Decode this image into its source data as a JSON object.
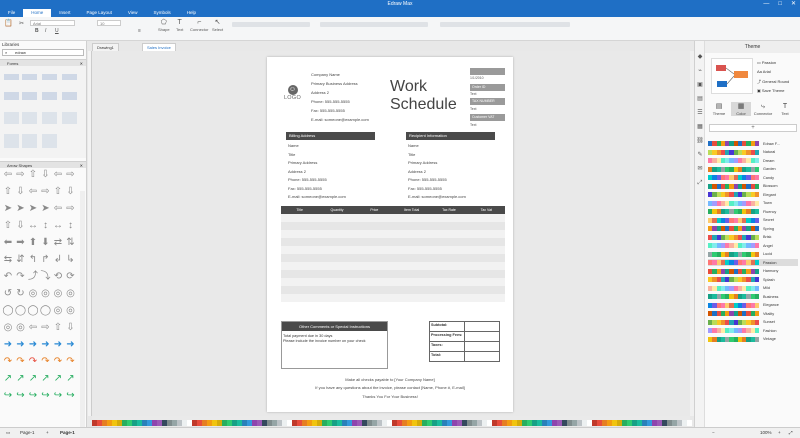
{
  "app": {
    "title": "Edraw Max",
    "win_controls": [
      "—",
      "□",
      "✕"
    ]
  },
  "menu": [
    "File",
    "Home",
    "Insert",
    "Page Layout",
    "View",
    "Symbols",
    "Help"
  ],
  "menu_active": "Home",
  "ribbon": {
    "font_name": "Arial",
    "font_size": "10",
    "tools": [
      "Shape",
      "Text",
      "Connector",
      "Select"
    ]
  },
  "library": {
    "title": "Libraries",
    "search_value": "edraw",
    "section_forms": "Forms",
    "section_arrows": "Arrow Shapes"
  },
  "tabs": [
    "Drawing1",
    "Sales Invoice"
  ],
  "doc": {
    "company_name": "Company Name",
    "address1": "Primary Business Address",
    "address2": "Address 2",
    "phone": "Phone: 555-555-5555",
    "fax": "Fax: 555-555-5555",
    "email": "E-mail: someone@example.com",
    "logo_text": "LOGO",
    "title_line1": "Work",
    "title_line2": "Schedule",
    "right_fields": [
      {
        "hd": "",
        "val": "1/1/2010"
      },
      {
        "hd": "Order ID",
        "val": "Text"
      },
      {
        "hd": "TAX NUMBER",
        "val": "Text"
      },
      {
        "hd": "Customer VAT",
        "val": "Text"
      }
    ],
    "billing_hd": "Billing Address",
    "billing": [
      "Name",
      "Title",
      "Primary Address",
      "Address 2",
      "Phone: 555-555-5555",
      "Fax: 555-555-5555",
      "E-mail: someone@example.com"
    ],
    "recipient_hd": "Recipient Information",
    "recipient": [
      "Name",
      "Title",
      "Primary Address",
      "Address 2",
      "Phone: 555-555-5555",
      "Fax: 555-555-5555",
      "E-mail: someone@example.com"
    ],
    "table_headers": [
      "Title",
      "Quantity",
      "Price",
      "Item Total",
      "Tax Rate",
      "Tax Vat"
    ],
    "comments_hd": "Other Comments or Special Instructions",
    "comments_line1": "Total payment due in 30 days",
    "comments_line2": "Please include the invoice number on your check",
    "totals": [
      "Subtotal:",
      "Processing Fees:",
      "Taxes:",
      "Total:"
    ],
    "footer1": "Make all checks payable to [Your Company Name]",
    "footer2": "If you have any questions about the invoice, please contact [Name, Phone #, E-mail]",
    "footer3": "Thanks You For Your Business!"
  },
  "theme": {
    "title": "Theme",
    "options": [
      "Passion",
      "Arial",
      "General Round",
      "Save Theme"
    ],
    "tabs": [
      "Theme",
      "Color",
      "Connector",
      "Text"
    ],
    "selected_tab": "Color",
    "selected_theme": "Passion",
    "list": [
      "Edraw F...",
      "Natural",
      "Dream",
      "Garden",
      "Candy",
      "Blossom",
      "Elegant",
      "Town",
      "Fluency",
      "Secret",
      "Spring",
      "Brisk",
      "Angel",
      "Lucid",
      "Passion",
      "Harmony",
      "Splash",
      "Mild",
      "Business",
      "Elegance",
      "Vitality",
      "Sunset",
      "Fashion",
      "Vintage"
    ]
  },
  "status": {
    "page_selector": "Page-1",
    "page_tab": "Page-1",
    "zoom": "100%"
  },
  "colors": {
    "accent": "#1f6fc5"
  }
}
